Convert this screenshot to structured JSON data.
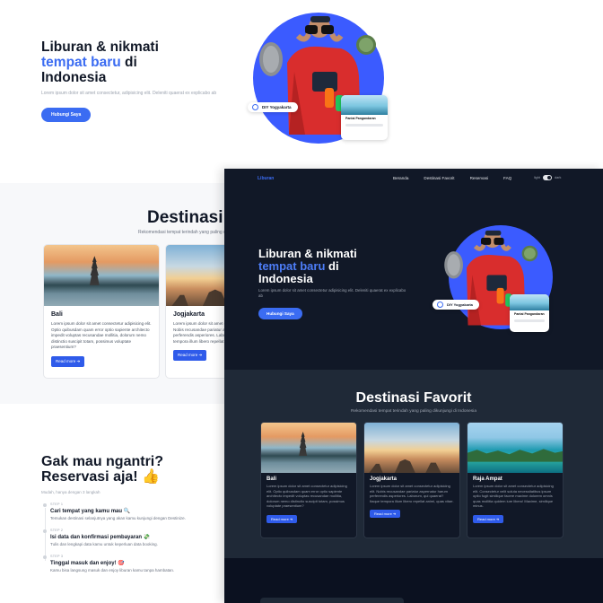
{
  "light": {
    "hero": {
      "title_line1": "Liburan & nikmati",
      "title_accent": "tempat baru",
      "title_suffix": " di",
      "title_line3": "Indonesia",
      "description": "Lorem ipsum dolor sit amet consectetur, adipisicing elit. Deleniti quaerat ex explicabo ab",
      "cta": "Hubungi Saya",
      "location_chip": "DIY Yogyakarta",
      "card_chip": "Pantai Pangandaran"
    },
    "destinations": {
      "title": "Destinasi Favorit",
      "subtitle": "Rekomendasi tempat terindah yang paling dikunjungi di Indonesia",
      "cards": [
        {
          "name": "Bali",
          "text": "Lorem ipsum dolor sit amet consectetur adipisicing elit. Optio quibusdam quam error optio sapiente architecto impedit voluptas recusandae mollitia, dolorum nemo distinctio suscipit totam, possimus voluptate praesentium?",
          "button": "Read more"
        },
        {
          "name": "Jogjakarta",
          "text": "Lorem ipsum dolor sit amet consectetur adipisicing elit. Nobis recusandae pariatur aspernatur harum perferendis asperiores. Laborum, qui quaerat? Itaque tempora illum libero repellat animi, quas vitae.",
          "button": "Read more"
        }
      ]
    },
    "reservation": {
      "title_line1": "Gak mau ngantri?",
      "title_line2": "Reservasi aja! 👍",
      "subtitle": "Mudah, hanya dengan 3 langkah",
      "steps": [
        {
          "label": "STEP 1",
          "title": "Cari tempat yang kamu mau 🔍",
          "desc": "Temukan destinasi selanjutnya yang akan kamu kunjungi dengan Destinize."
        },
        {
          "label": "STEP 2",
          "title": "Isi data dan konfirmasi pembayaran 💸",
          "desc": "Tulis dan lengkapi data kamu untuk keperluan data booking."
        },
        {
          "label": "STEP 3",
          "title": "Tinggal masuk dan enjoy! 🎯",
          "desc": "Kamu bisa langsung masuk dan enjoy liburan kamu tanpa hambatan."
        }
      ]
    }
  },
  "dark": {
    "nav": {
      "logo": "Liburan",
      "links": [
        "Beranda",
        "Destinasi Favorit",
        "Reservasi",
        "FAQ"
      ],
      "toggle_left": "light",
      "toggle_right": "dark"
    },
    "hero": {
      "title_line1": "Liburan & nikmati",
      "title_accent": "tempat baru",
      "title_suffix": " di",
      "title_line3": "Indonesia",
      "description": "Lorem ipsum dolor sit amet consectetur adipisicing elit. Deleniti quaerat ex explicabo ab",
      "cta": "Hubungi Saya",
      "location_chip": "DIY Yogyakarta",
      "card_chip": "Pantai Pangandaran"
    },
    "destinations": {
      "title": "Destinasi Favorit",
      "subtitle": "Rekomendasi tempat terindah yang paling dikunjungi di Indonesia",
      "cards": [
        {
          "name": "Bali",
          "text": "Lorem ipsum dolor sit amet consectetur adipisicing elit. Optio quibusdam quam error optio sapiente architecto impedit voluptas recusandae mollitia, dolorum nemo distinctio suscipit totam, possimus voluptate praesentium?",
          "button": "Read more"
        },
        {
          "name": "Jogjakarta",
          "text": "Lorem ipsum dolor sit amet consectetur adipisicing elit. Nobis recusandae pariatur aspernatur harum perferendis asperiores. Laborum, qui quaerat? Itaque tempora illum libero repellat animi, quas vitae.",
          "button": "Read more"
        },
        {
          "name": "Raja Ampat",
          "text": "Lorem ipsum dolor sit amet consectetur adipisicing elit. Consectetur velit soluta necessitatibus ipsum optio fugit similique facere maxime dolorem omnis quas mollitia quidem iure libero! Maxime, similique minus.",
          "button": "Read more"
        }
      ]
    }
  },
  "colors": {
    "accent": "#3b6cf2",
    "button": "#2f5bea",
    "dark_bg": "#111827",
    "dark_section": "#1f2937"
  }
}
